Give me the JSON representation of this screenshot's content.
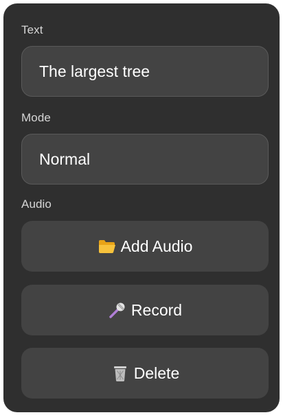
{
  "text_section": {
    "label": "Text",
    "value": "The largest tree"
  },
  "mode_section": {
    "label": "Mode",
    "value": "Normal"
  },
  "audio_section": {
    "label": "Audio",
    "buttons": [
      {
        "label": "Add Audio",
        "icon": "folder-icon"
      },
      {
        "label": "Record",
        "icon": "microphone-icon"
      },
      {
        "label": "Delete",
        "icon": "trash-icon"
      }
    ]
  }
}
